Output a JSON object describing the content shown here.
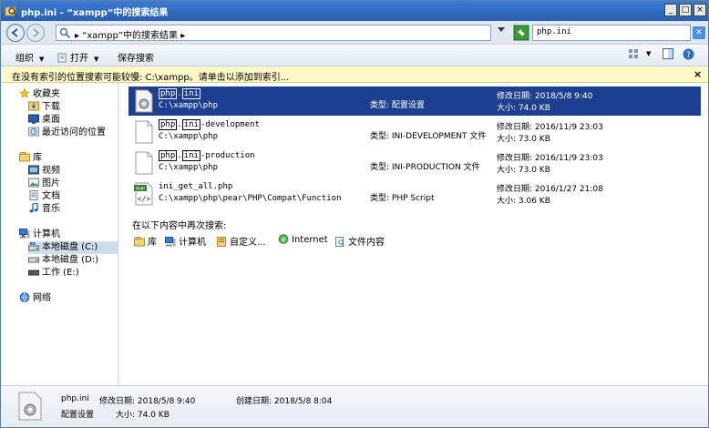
{
  "window": {
    "title": "php.ini - “xampp”中的搜索结果",
    "minimize": "_",
    "maximize": "□",
    "close": "×"
  },
  "address": {
    "breadcrumb": "▸ “xampp”中的搜索结果 ▸",
    "search_value": "php.ini"
  },
  "toolbar": {
    "organize": "组织",
    "open": "打开",
    "save_search": "保存搜索"
  },
  "infobar": {
    "text": "在没有索引的位置搜索可能较慢: C:\\xampp。请单击以添加到索引...",
    "close": "×"
  },
  "nav": {
    "favorites": "收藏夹",
    "downloads": "下载",
    "desktop": "桌面",
    "recent": "最近访问的位置",
    "libraries": "库",
    "videos": "视频",
    "pictures": "图片",
    "documents": "文档",
    "music": "音乐",
    "computer": "计算机",
    "drive_c": "本地磁盘 (C:)",
    "drive_d": "本地磁盘 (D:)",
    "drive_e": "工作 (E:)",
    "network": "网络"
  },
  "results": [
    {
      "name_a": "php",
      "name_b": "ini",
      "name_c": "",
      "path": "C:\\xampp\\php",
      "type": "类型: 配置设置",
      "date": "修改日期: 2018/5/8 9:40",
      "size": "大小: 74.0 KB"
    },
    {
      "name_a": "php",
      "name_b": "ini",
      "name_c": "-development",
      "path": "C:\\xampp\\php",
      "type": "类型: INI-DEVELOPMENT 文件",
      "date": "修改日期: 2016/11/9 23:03",
      "size": "大小: 73.0 KB"
    },
    {
      "name_a": "php",
      "name_b": "ini",
      "name_c": "-production",
      "path": "C:\\xampp\\php",
      "type": "类型: INI-PRODUCTION 文件",
      "date": "修改日期: 2016/11/9 23:03",
      "size": "大小: 73.0 KB"
    },
    {
      "name_full": "ini_get_all.php",
      "path": "C:\\xampp\\php\\pear\\PHP\\Compat\\Function",
      "type": "类型: PHP Script",
      "date": "修改日期: 2016/1/27 21:08",
      "size": "大小: 3.06 KB"
    }
  ],
  "search_again": {
    "label": "在以下内容中再次搜索:",
    "libraries": "库",
    "computer": "计算机",
    "custom": "自定义...",
    "internet": "Internet",
    "file_contents": "文件内容"
  },
  "details": {
    "filename": "php.ini",
    "modified": "修改日期: 2018/5/8 9:40",
    "created": "创建日期: 2018/5/8 8:04",
    "type": "配置设置",
    "size": "大小: 74.0 KB"
  },
  "colors": {
    "selection": "#1d3f8f",
    "infobar": "#fff9c8",
    "titlebar": "#2a5fae"
  }
}
